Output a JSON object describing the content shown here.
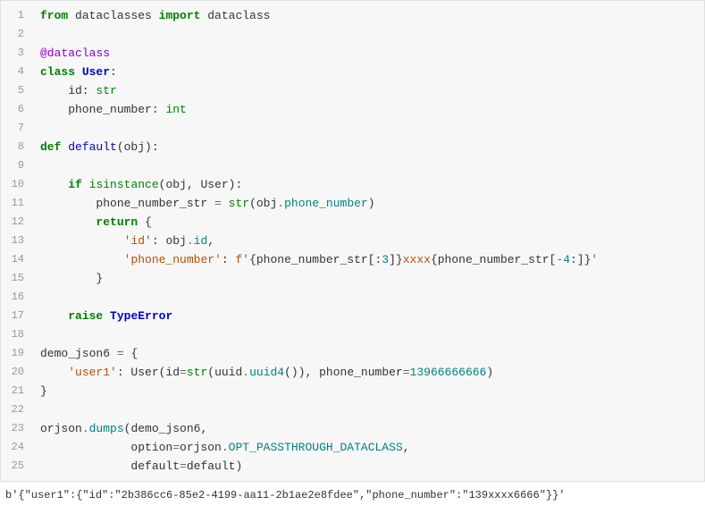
{
  "code": {
    "lines": [
      {
        "n": "1",
        "html": "<span class='kw'>from</span> dataclasses <span class='kw'>import</span> dataclass"
      },
      {
        "n": "2",
        "html": ""
      },
      {
        "n": "3",
        "html": "<span class='dec'>@dataclass</span>"
      },
      {
        "n": "4",
        "html": "<span class='kw'>class</span> <span class='cls'>User</span>:"
      },
      {
        "n": "5",
        "html": "    id: <span class='typ'>str</span>"
      },
      {
        "n": "6",
        "html": "    phone_number: <span class='typ'>int</span>"
      },
      {
        "n": "7",
        "html": ""
      },
      {
        "n": "8",
        "html": "<span class='kw'>def</span> <span class='fn'>default</span>(obj):"
      },
      {
        "n": "9",
        "html": ""
      },
      {
        "n": "10",
        "html": "    <span class='kw'>if</span> <span class='typ'>isinstance</span>(obj, User):"
      },
      {
        "n": "11",
        "html": "        phone_number_str <span class='op'>=</span> <span class='typ'>str</span>(obj<span class='op'>.</span><span class='attr'>phone_number</span>)"
      },
      {
        "n": "12",
        "html": "        <span class='kw'>return</span> {"
      },
      {
        "n": "13",
        "html": "            <span class='str'>'id'</span>: obj<span class='op'>.</span><span class='attr'>id</span>,"
      },
      {
        "n": "14",
        "html": "            <span class='str'>'phone_number'</span>: <span class='str'>f'</span>{phone_number_str[:<span class='num'>3</span>]}<span class='str'>xxxx</span>{phone_number_str[<span class='op'>-</span><span class='num'>4</span>:]}<span class='str'>'</span>"
      },
      {
        "n": "15",
        "html": "        }"
      },
      {
        "n": "16",
        "html": ""
      },
      {
        "n": "17",
        "html": "    <span class='kw'>raise</span> <span class='cls'>TypeError</span>"
      },
      {
        "n": "18",
        "html": ""
      },
      {
        "n": "19",
        "html": "demo_json6 <span class='op'>=</span> {"
      },
      {
        "n": "20",
        "html": "    <span class='str'>'user1'</span>: User(id<span class='op'>=</span><span class='typ'>str</span>(uuid<span class='op'>.</span><span class='attr'>uuid4</span>()), phone_number<span class='op'>=</span><span class='num'>13966666666</span>)"
      },
      {
        "n": "21",
        "html": "}"
      },
      {
        "n": "22",
        "html": ""
      },
      {
        "n": "23",
        "html": "orjson<span class='op'>.</span><span class='attr'>dumps</span>(demo_json6,"
      },
      {
        "n": "24",
        "html": "             option<span class='op'>=</span>orjson<span class='op'>.</span><span class='attr'>OPT_PASSTHROUGH_DATACLASS</span>,"
      },
      {
        "n": "25",
        "html": "             default<span class='op'>=</span>default)"
      }
    ]
  },
  "output": "b'{\"user1\":{\"id\":\"2b386cc6-85e2-4199-aa11-2b1ae2e8fdee\",\"phone_number\":\"139xxxx6666\"}}'"
}
